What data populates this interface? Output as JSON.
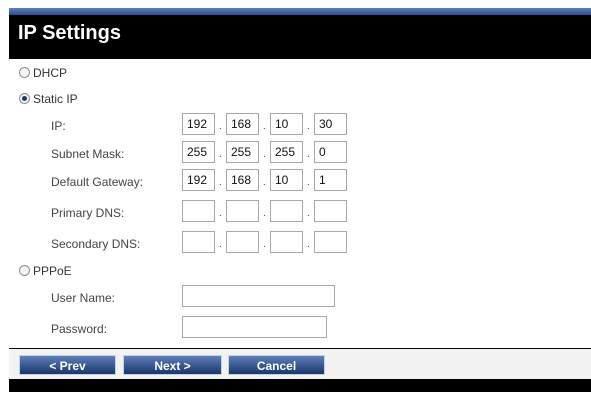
{
  "window": {
    "title": "IP Settings"
  },
  "modes": {
    "dhcp": {
      "label": "DHCP",
      "checked": false
    },
    "static": {
      "label": "Static IP",
      "checked": true
    },
    "pppoe": {
      "label": "PPPoE",
      "checked": false
    }
  },
  "static_fields": [
    {
      "label": "IP:",
      "octets": [
        "192",
        "168",
        "10",
        "30"
      ]
    },
    {
      "label": "Subnet Mask:",
      "octets": [
        "255",
        "255",
        "255",
        "0"
      ]
    },
    {
      "label": "Default Gateway:",
      "octets": [
        "192",
        "168",
        "10",
        "1"
      ]
    },
    {
      "label": "Primary DNS:",
      "octets": [
        "",
        "",
        "",
        ""
      ]
    },
    {
      "label": "Secondary DNS:",
      "octets": [
        "",
        "",
        "",
        ""
      ]
    }
  ],
  "pppoe_fields": {
    "username_label": "User Name:",
    "username_value": "",
    "password_label": "Password:",
    "password_value": ""
  },
  "buttons": {
    "prev": "< Prev",
    "next": "Next >",
    "cancel": "Cancel"
  },
  "colors": {
    "title_bar": "#000000",
    "button": "#2c4f8f",
    "accent_line": "#5c7fbc"
  }
}
